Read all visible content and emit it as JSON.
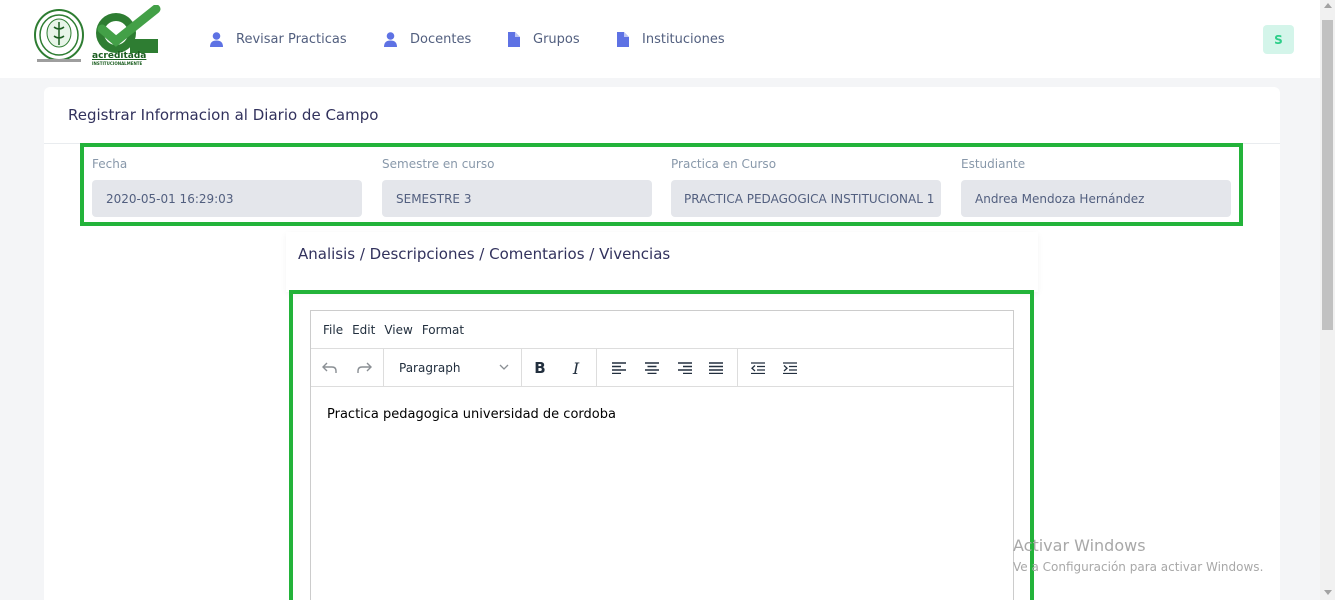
{
  "nav": {
    "items": [
      {
        "label": "Revisar Practicas",
        "icon": "user-icon"
      },
      {
        "label": "Docentes",
        "icon": "user-icon"
      },
      {
        "label": "Grupos",
        "icon": "file-icon"
      },
      {
        "label": "Instituciones",
        "icon": "file-icon"
      }
    ],
    "avatar": "S",
    "logo_text": "acreditada",
    "logo_subtext": "INSTITUCIONALMENTE"
  },
  "card": {
    "title": "Registrar Informacion al Diario de Campo",
    "fields": [
      {
        "label": "Fecha",
        "value": "2020-05-01 16:29:03"
      },
      {
        "label": "Semestre en curso",
        "value": "SEMESTRE 3"
      },
      {
        "label": "Practica en Curso",
        "value": "PRACTICA PEDAGOGICA INSTITUCIONAL 1"
      },
      {
        "label": "Estudiante",
        "value": "Andrea Mendoza Hernández"
      }
    ],
    "section_title": "Analisis / Descripciones / Comentarios / Vivencias"
  },
  "editor": {
    "menu": [
      "File",
      "Edit",
      "View",
      "Format"
    ],
    "block_format": "Paragraph",
    "content": "Practica pedagogica universidad de cordoba"
  },
  "watermark": {
    "title": "Activar Windows",
    "subtitle": "Ve a Configuración para activar Windows."
  },
  "colors": {
    "highlight": "#23b33a",
    "accent": "#5e72e4",
    "avatar_bg": "#d4f5ea",
    "avatar_fg": "#2dce89"
  }
}
